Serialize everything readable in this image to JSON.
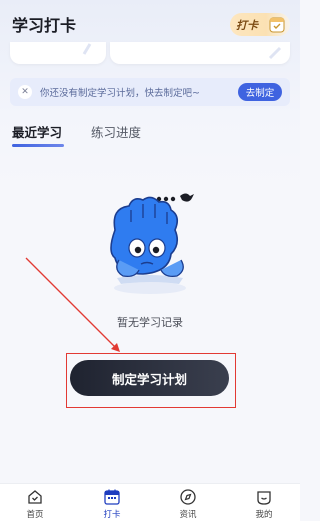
{
  "header": {
    "title": "学习打卡",
    "checkin_badge": "打卡"
  },
  "reminder": {
    "message": "你还没有制定学习计划，快去制定吧~",
    "action_label": "去制定"
  },
  "tabs": [
    {
      "label": "最近学习",
      "active": true
    },
    {
      "label": "练习进度",
      "active": false
    }
  ],
  "empty_state": {
    "text": "暂无学习记录"
  },
  "cta": {
    "label": "制定学习计划"
  },
  "bottom_nav": [
    {
      "label": "首页",
      "icon": "home-icon",
      "active": false
    },
    {
      "label": "打卡",
      "icon": "calendar-icon",
      "active": true
    },
    {
      "label": "资讯",
      "icon": "compass-icon",
      "active": false
    },
    {
      "label": "我的",
      "icon": "profile-icon",
      "active": false
    }
  ],
  "colors": {
    "accent": "#3f63e0",
    "cta_dark": "#1f2330",
    "highlight_red": "#e23a33",
    "mascot_blue": "#2f7cf0"
  }
}
